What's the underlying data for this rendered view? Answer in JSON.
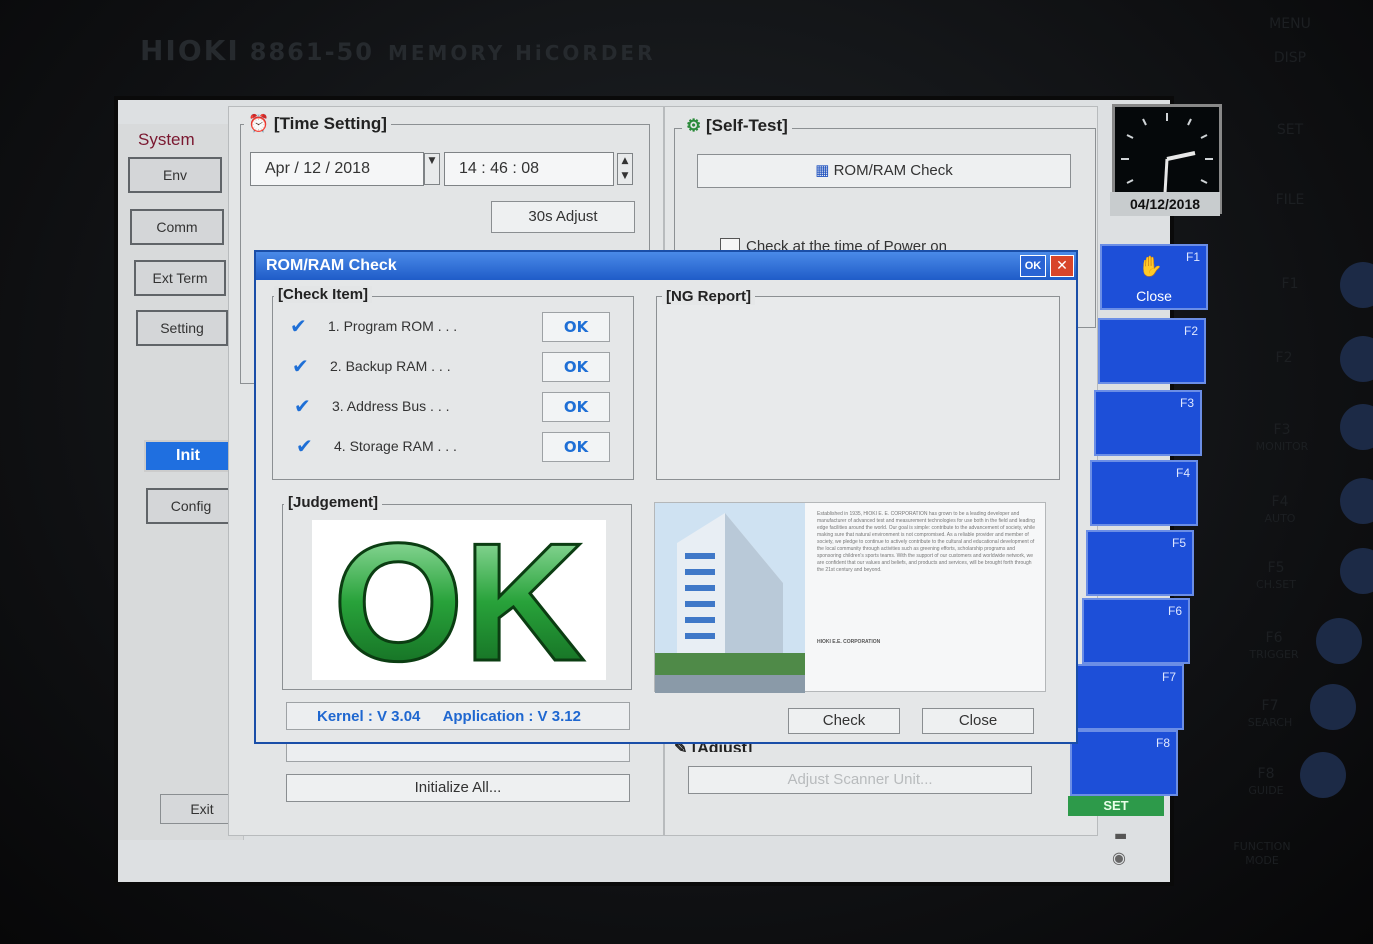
{
  "device": {
    "brand": "HIOKI",
    "model": "8861-50",
    "product": "MEMORY HiCORDER"
  },
  "front_panel_labels": [
    "MENU",
    "DISP",
    "SET",
    "FILE",
    "F1",
    "F2",
    "F3",
    "MONITOR",
    "F4",
    "AUTO",
    "F5",
    "CH.SET",
    "F6",
    "TRIGGER",
    "F7",
    "SEARCH",
    "F8",
    "GUIDE",
    "FUNCTION",
    "MODE"
  ],
  "system_menu": {
    "title": "System",
    "items": [
      {
        "label": "Env"
      },
      {
        "label": "Comm"
      },
      {
        "label": "Ext Term"
      },
      {
        "label": "Setting"
      },
      {
        "label": "Init"
      },
      {
        "label": "Config"
      }
    ],
    "exit_label": "Exit"
  },
  "time_setting": {
    "title": "[Time Setting]",
    "date": "Apr / 12 / 2018",
    "time": "14 : 46 : 08",
    "adjust_label": "30s Adjust"
  },
  "self_test": {
    "title": "[Self-Test]",
    "rom_ram_label": "ROM/RAM Check",
    "power_on_check_label": "Check at the time of Power on"
  },
  "init_section": {
    "init_all_label": "Initialize All...",
    "adjust_title": "[Adjust]",
    "adjust_scanner_label": "Adjust Scanner Unit..."
  },
  "clock": {
    "date": "04/12/2018"
  },
  "function_keys": [
    {
      "label": "F1",
      "text": "Close"
    },
    {
      "label": "F2",
      "text": ""
    },
    {
      "label": "F3",
      "text": ""
    },
    {
      "label": "F4",
      "text": ""
    },
    {
      "label": "F5",
      "text": ""
    },
    {
      "label": "F6",
      "text": ""
    },
    {
      "label": "F7",
      "text": ""
    },
    {
      "label": "F8",
      "text": ""
    }
  ],
  "set_label": "SET",
  "dialog": {
    "title": "ROM/RAM Check",
    "ok_label": "OK",
    "check_item_title": "[Check Item]",
    "items": [
      {
        "label": "1. Program ROM . . .",
        "result": "OK"
      },
      {
        "label": "2. Backup RAM . . .",
        "result": "OK"
      },
      {
        "label": "3. Address Bus . . .",
        "result": "OK"
      },
      {
        "label": "4. Storage RAM . . .",
        "result": "OK"
      }
    ],
    "ng_report_title": "[NG Report]",
    "judgement_title": "[Judgement]",
    "judgement_result": "OK",
    "kernel": "Kernel : V 3.04",
    "application": "Application : V 3.12",
    "corp_text": "Established in 1935, HIOKI E. E. CORPORATION has grown to be a leading developer and manufacturer of advanced test and measurement technologies for use both in the field and leading edge facilities around the world. Our goal is simple: contribute to the advancement of society, while making sure that natural environment is not compromised. As a reliable provider and member of society, we pledge to continue to actively contribute to the cultural and educational development of the local community through activities such as greening efforts, scholarship programs and sponsoring children's sports teams. With the support of our customers and worldwide network, we are confident that our values and beliefs, and products and services, will be brought forth through the 21st century and beyond.",
    "corp_signature": "HIOKI E.E. CORPORATION",
    "check_button": "Check",
    "close_button": "Close"
  }
}
